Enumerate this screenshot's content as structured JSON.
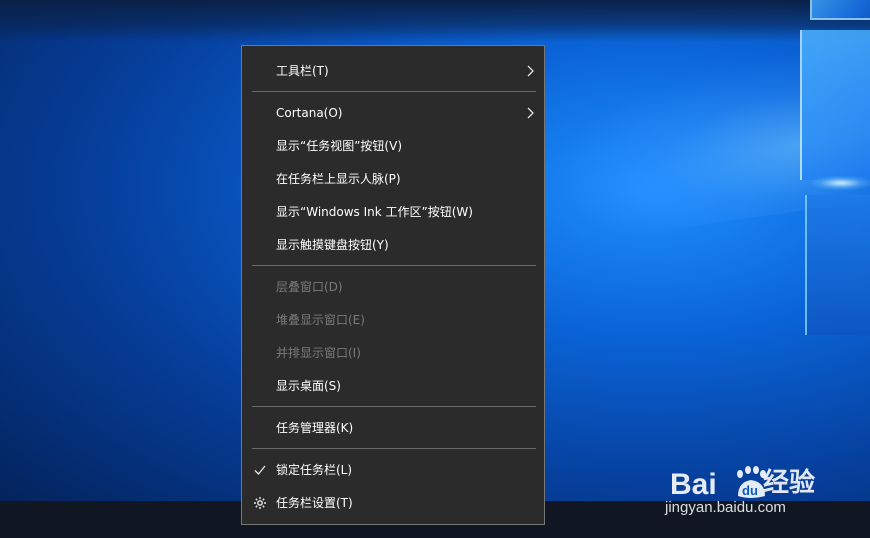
{
  "menu": {
    "items": [
      {
        "label": "工具栏(T)",
        "submenu": true
      },
      {
        "label": "Cortana(O)",
        "submenu": true
      },
      {
        "label": "显示“任务视图”按钮(V)"
      },
      {
        "label": "在任务栏上显示人脉(P)"
      },
      {
        "label": "显示“Windows Ink 工作区”按钮(W)"
      },
      {
        "label": "显示触摸键盘按钮(Y)"
      },
      {
        "label": "层叠窗口(D)",
        "disabled": true
      },
      {
        "label": "堆叠显示窗口(E)",
        "disabled": true
      },
      {
        "label": "并排显示窗口(I)",
        "disabled": true
      },
      {
        "label": "显示桌面(S)"
      },
      {
        "label": "任务管理器(K)"
      },
      {
        "label": "锁定任务栏(L)",
        "checked": true
      },
      {
        "label": "任务栏设置(T)",
        "icon": "gear-icon"
      }
    ]
  },
  "watermark": {
    "brand": "经验",
    "url": "jingyan.baidu.com",
    "logo": "Bai du paw"
  },
  "colors": {
    "menu_bg": "#2b2b2b",
    "menu_text": "#ffffff",
    "disabled_text": "#7a7a7a",
    "separator": "#6a6a6a"
  }
}
